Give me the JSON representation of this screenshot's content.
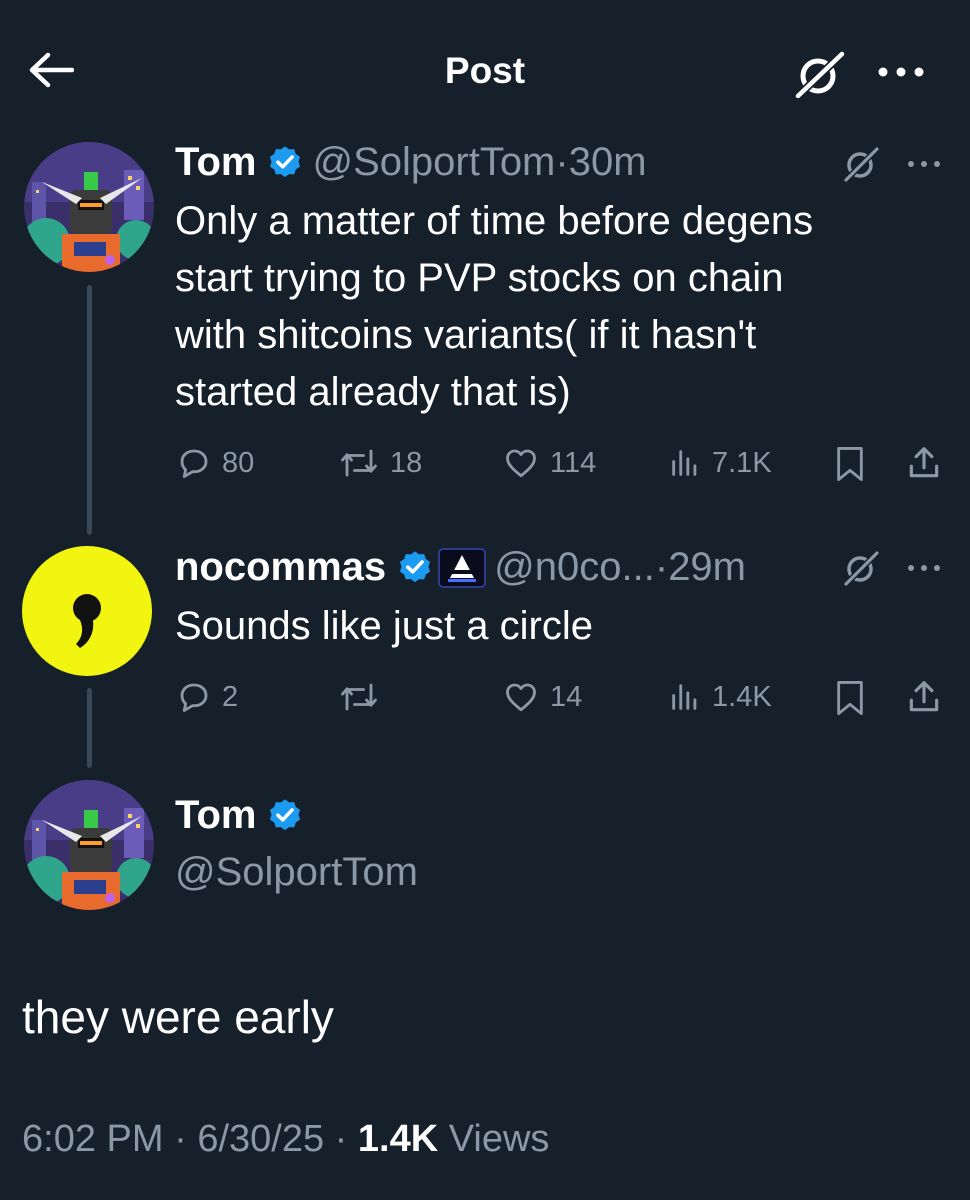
{
  "header": {
    "title": "Post",
    "back_icon": "arrow-left-icon",
    "grok_icon": "grok-icon",
    "more_icon": "more-horizontal-icon"
  },
  "thread": [
    {
      "name": "Tom",
      "verified": true,
      "handle": "@SolportTom",
      "separator": "·",
      "time": "30m",
      "text_lines": [
        "Only a matter of time before degens",
        "start trying to PVP stocks on chain",
        "with shitcoins variants( if it hasn't",
        "started already that is)"
      ],
      "replies": "80",
      "reposts": "18",
      "likes": "114",
      "views": "7.1K"
    },
    {
      "name": "nocommas",
      "verified": true,
      "affiliate_badge": "triangle-logo-icon",
      "handle": "@n0co...",
      "separator": "·",
      "time": "29m",
      "text_lines": [
        "Sounds like just a circle"
      ],
      "replies": "2",
      "reposts": "",
      "likes": "14",
      "views": "1.4K"
    }
  ],
  "main_post": {
    "name": "Tom",
    "verified": true,
    "handle": "@SolportTom",
    "text": "they were early",
    "time": "6:02 PM",
    "date": "6/30/25",
    "separator": "·",
    "views_count": "1.4K",
    "views_label": "Views"
  },
  "colors": {
    "background": "#15202b",
    "text_primary": "#ffffff",
    "text_secondary": "#8b98a5",
    "verified_blue": "#1d9bf0",
    "nocommas_avatar": "#f2f50f",
    "thread_line": "#3a4754"
  }
}
